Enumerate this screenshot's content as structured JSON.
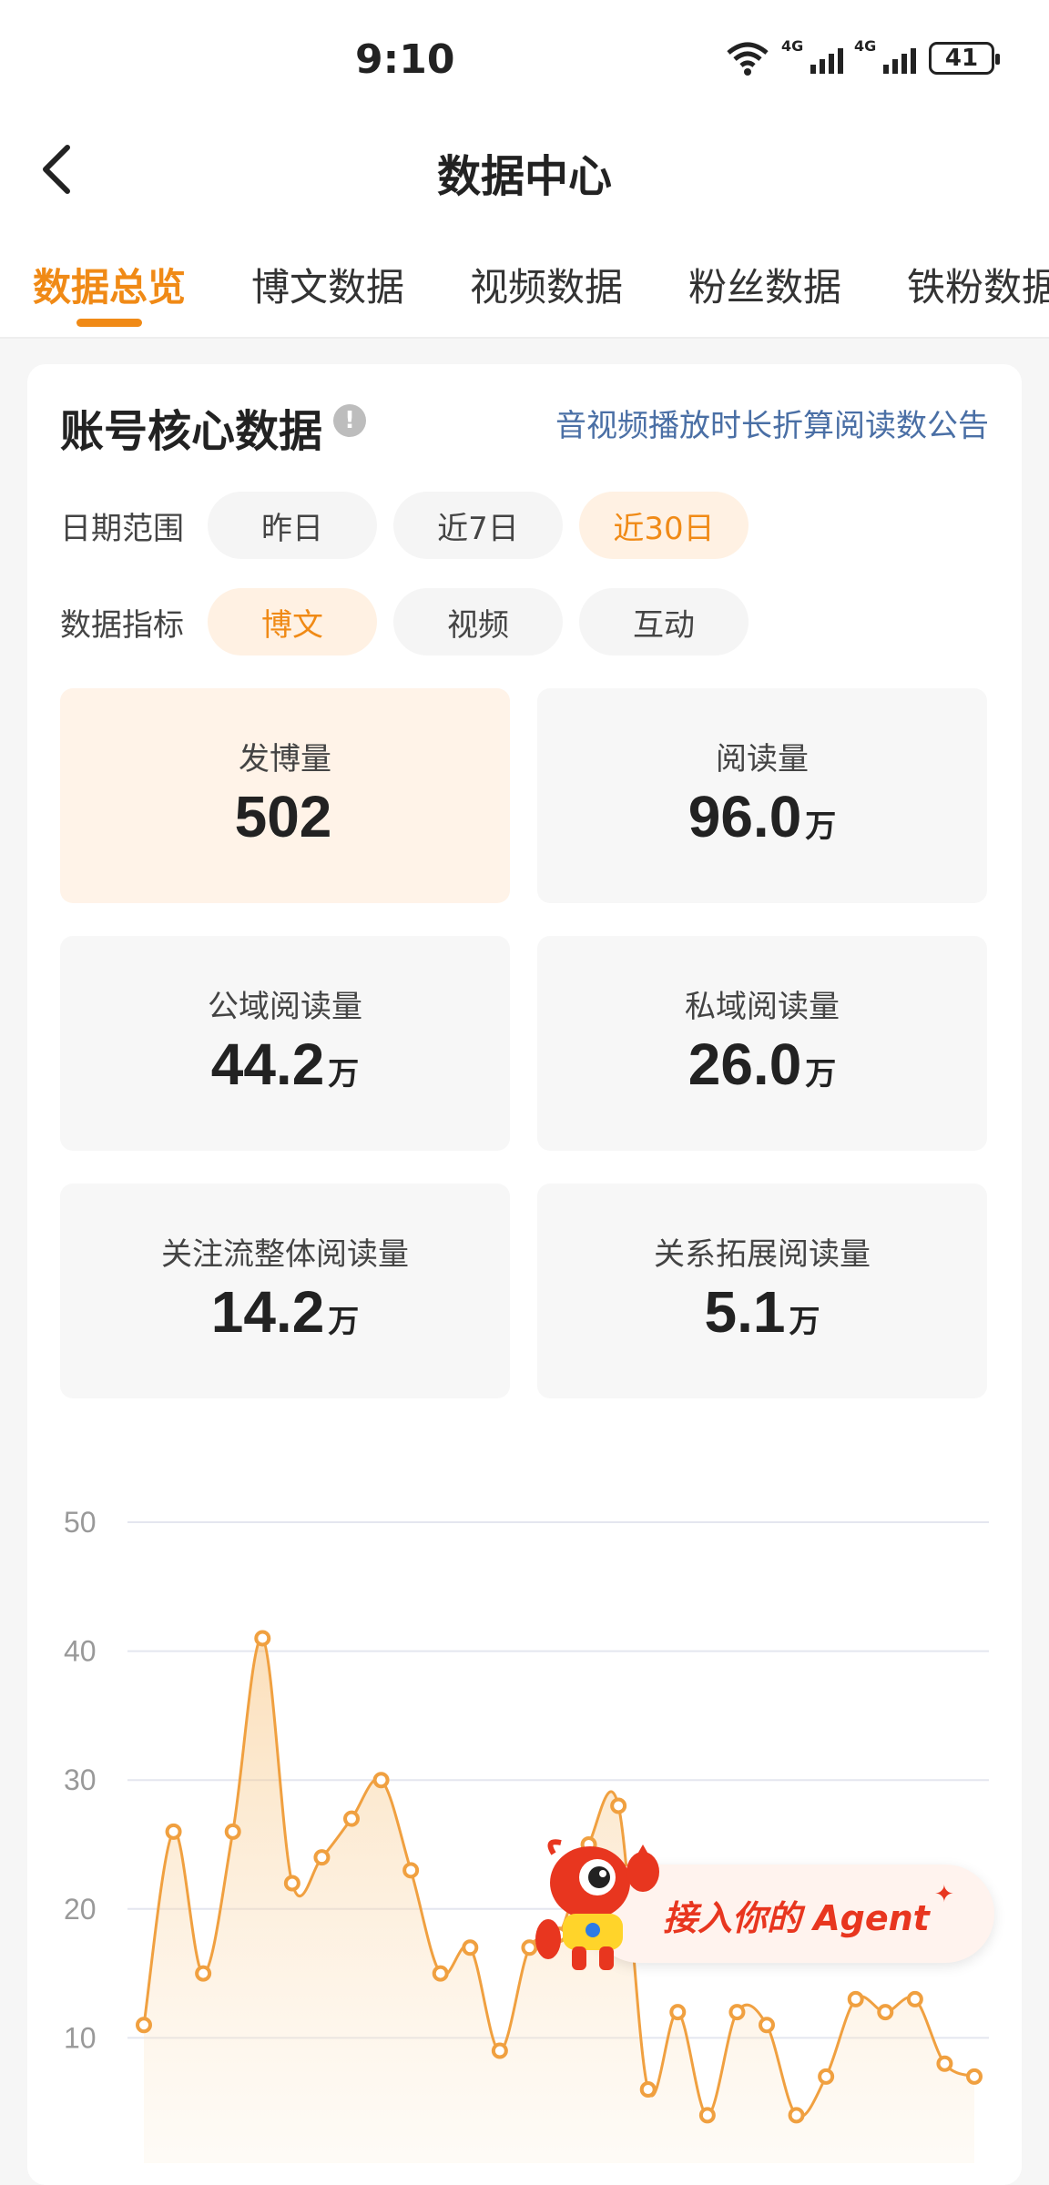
{
  "status_bar": {
    "time": "9:10",
    "battery": "41",
    "signal_labels": [
      "4G",
      "4G"
    ]
  },
  "nav": {
    "title": "数据中心"
  },
  "tabs": [
    {
      "label": "数据总览",
      "active": true
    },
    {
      "label": "博文数据",
      "active": false
    },
    {
      "label": "视频数据",
      "active": false
    },
    {
      "label": "粉丝数据",
      "active": false
    },
    {
      "label": "铁粉数据",
      "active": false
    }
  ],
  "card": {
    "title": "账号核心数据",
    "notice_link": "音视频播放时长折算阅读数公告",
    "date_range": {
      "label": "日期范围",
      "options": [
        "昨日",
        "近7日",
        "近30日"
      ],
      "selected": "近30日"
    },
    "metric_type": {
      "label": "数据指标",
      "options": [
        "博文",
        "视频",
        "互动"
      ],
      "selected": "博文"
    },
    "metrics": [
      {
        "label": "发博量",
        "value": "502",
        "unit": "",
        "active": true
      },
      {
        "label": "阅读量",
        "value": "96.0",
        "unit": "万",
        "active": false
      },
      {
        "label": "公域阅读量",
        "value": "44.2",
        "unit": "万",
        "active": false
      },
      {
        "label": "私域阅读量",
        "value": "26.0",
        "unit": "万",
        "active": false
      },
      {
        "label": "关注流整体阅读量",
        "value": "14.2",
        "unit": "万",
        "active": false
      },
      {
        "label": "关系拓展阅读量",
        "value": "5.1",
        "unit": "万",
        "active": false
      }
    ]
  },
  "chart_data": {
    "type": "area",
    "y_ticks": [
      50,
      40,
      30,
      20,
      10
    ],
    "ylim": [
      0,
      50
    ],
    "grid": true,
    "line_color": "#f0a040",
    "values": [
      11,
      26,
      15,
      26,
      41,
      22,
      24,
      27,
      30,
      23,
      15,
      17,
      9,
      17,
      18,
      25,
      28,
      6,
      12,
      4,
      12,
      11,
      4,
      7,
      13,
      12,
      13,
      8,
      7
    ]
  },
  "agent_button": {
    "label": "接入你的 Agent",
    "sparkle": "✦"
  },
  "colors": {
    "accent": "#f08a16",
    "link": "#4a6fa5",
    "agent": "#e8361f"
  }
}
